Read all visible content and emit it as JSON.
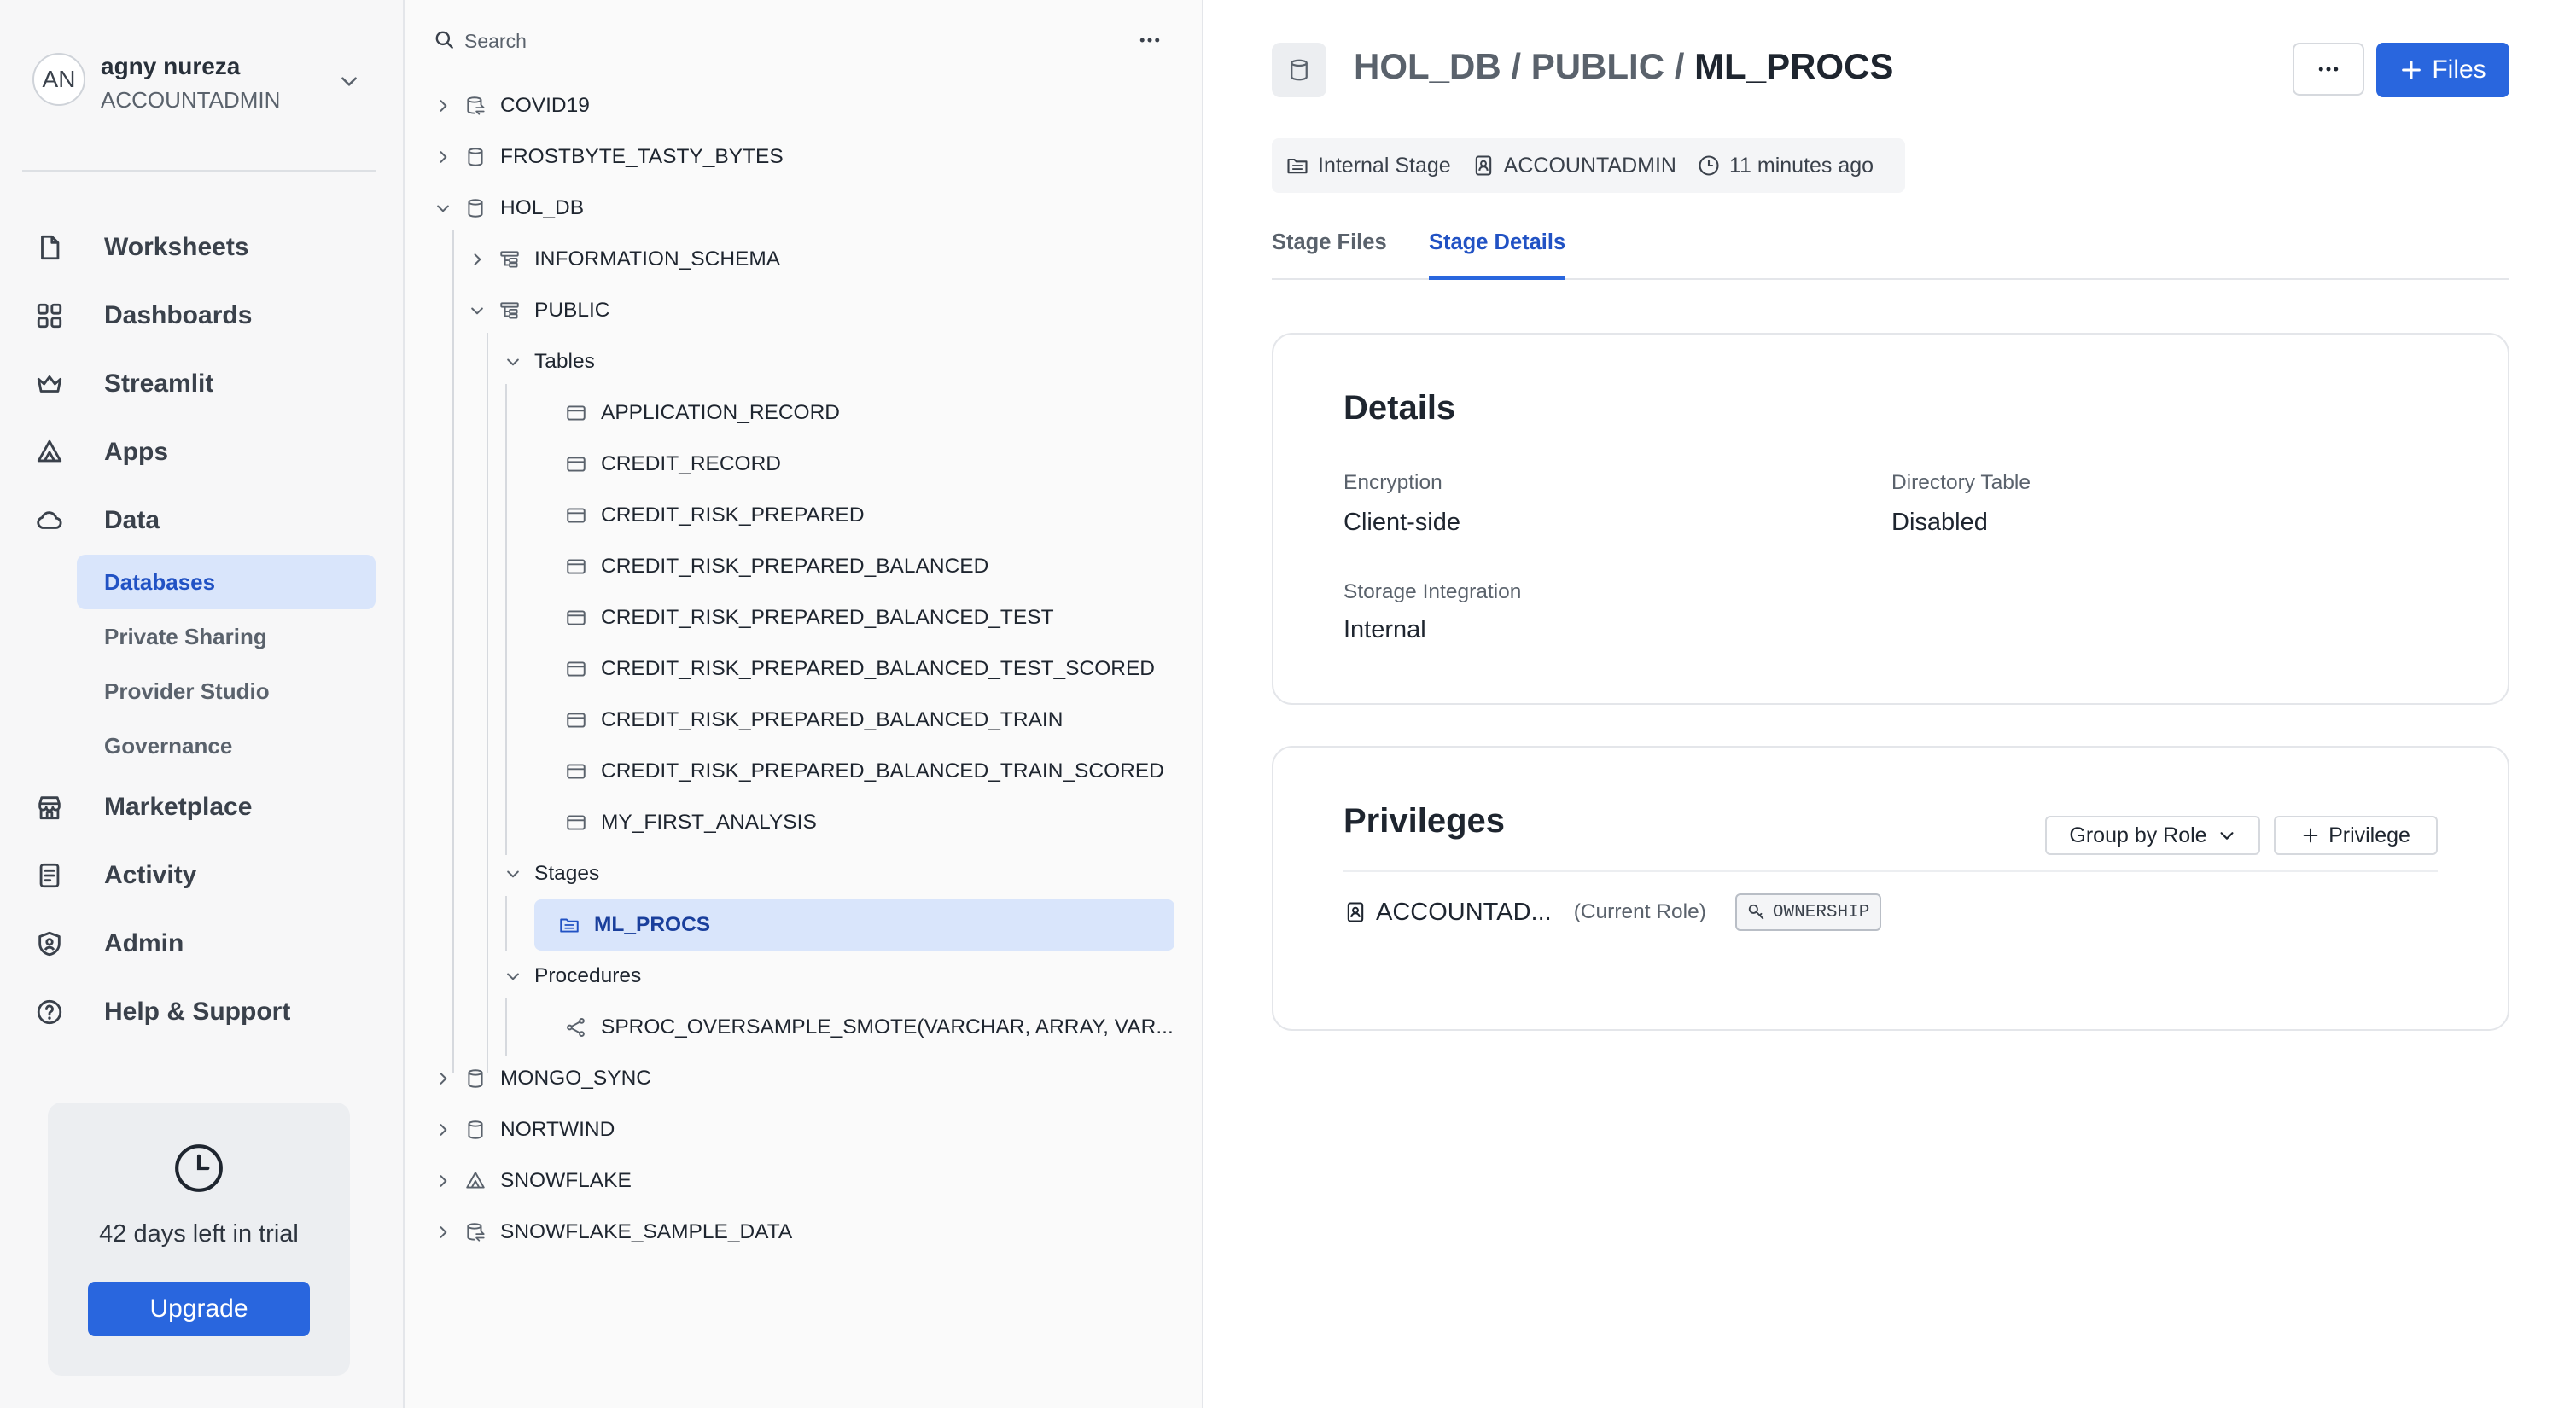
{
  "user": {
    "initials": "AN",
    "name": "agny nureza",
    "role": "ACCOUNTADMIN"
  },
  "nav": {
    "items": [
      {
        "label": "Worksheets",
        "icon": "file-icon"
      },
      {
        "label": "Dashboards",
        "icon": "grid-icon"
      },
      {
        "label": "Streamlit",
        "icon": "crown-icon"
      },
      {
        "label": "Apps",
        "icon": "apps-icon"
      },
      {
        "label": "Data",
        "icon": "cloud-icon"
      },
      {
        "label": "Marketplace",
        "icon": "store-icon"
      },
      {
        "label": "Activity",
        "icon": "activity-icon"
      },
      {
        "label": "Admin",
        "icon": "shield-icon"
      },
      {
        "label": "Help & Support",
        "icon": "help-icon"
      }
    ],
    "data_sub": [
      "Databases",
      "Private Sharing",
      "Provider Studio",
      "Governance"
    ],
    "active_sub": "Databases"
  },
  "trial": {
    "text": "42 days left in trial",
    "button": "Upgrade"
  },
  "tree": {
    "search_placeholder": "Search",
    "databases": [
      "COVID19",
      "FROSTBYTE_TASTY_BYTES",
      "HOL_DB",
      "MONGO_SYNC",
      "NORTWIND",
      "SNOWFLAKE",
      "SNOWFLAKE_SAMPLE_DATA"
    ],
    "schemas": [
      "INFORMATION_SCHEMA",
      "PUBLIC"
    ],
    "groups": {
      "tables": "Tables",
      "stages": "Stages",
      "procedures": "Procedures"
    },
    "tables": [
      "APPLICATION_RECORD",
      "CREDIT_RECORD",
      "CREDIT_RISK_PREPARED",
      "CREDIT_RISK_PREPARED_BALANCED",
      "CREDIT_RISK_PREPARED_BALANCED_TEST",
      "CREDIT_RISK_PREPARED_BALANCED_TEST_SCORED",
      "CREDIT_RISK_PREPARED_BALANCED_TRAIN",
      "CREDIT_RISK_PREPARED_BALANCED_TRAIN_SCORED",
      "MY_FIRST_ANALYSIS"
    ],
    "stages": [
      "ML_PROCS"
    ],
    "procedures": [
      "SPROC_OVERSAMPLE_SMOTE(VARCHAR, ARRAY, VAR..."
    ]
  },
  "main": {
    "breadcrumb": {
      "db": "HOL_DB",
      "sep": " / ",
      "schema": "PUBLIC",
      "object": "ML_PROCS"
    },
    "files_button": "Files",
    "meta": {
      "type": "Internal Stage",
      "owner": "ACCOUNTADMIN",
      "time": "11 minutes ago"
    },
    "tabs": [
      "Stage Files",
      "Stage Details"
    ],
    "active_tab": "Stage Details",
    "details": {
      "title": "Details",
      "encryption_label": "Encryption",
      "encryption_value": "Client-side",
      "directory_label": "Directory Table",
      "directory_value": "Disabled",
      "storage_label": "Storage Integration",
      "storage_value": "Internal"
    },
    "privileges": {
      "title": "Privileges",
      "group_by": "Group by Role",
      "add": "Privilege",
      "role": "ACCOUNTAD...",
      "current": "(Current Role)",
      "privilege": "OWNERSHIP"
    }
  },
  "colors": {
    "accent": "#2966de",
    "active_bg": "#d9e5fb",
    "active_text": "#2152c4"
  }
}
